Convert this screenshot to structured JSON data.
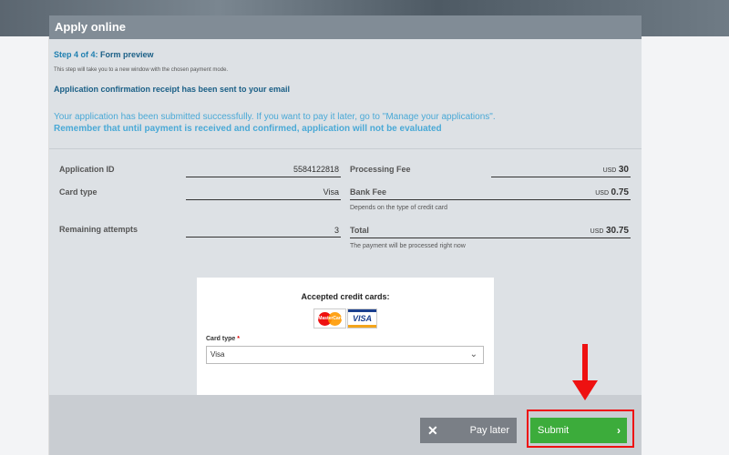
{
  "panel": {
    "title": "Apply online",
    "step_prefix": "Step 4 of 4:",
    "step_name": "Form preview",
    "step_note": "This step will take you to a new window with the chosen payment mode.",
    "confirmation": "Application confirmation receipt has been sent to your email",
    "success_msg": "Your application has been submitted successfully. If you want to pay it later, go to \"Manage your applications\".",
    "remember_msg": "Remember that until payment is received and confirmed, application will not be evaluated"
  },
  "fields": {
    "app_id": {
      "label": "Application ID",
      "value": "5584122818"
    },
    "card_type": {
      "label": "Card type",
      "value": "Visa"
    },
    "attempts": {
      "label": "Remaining attempts",
      "value": "3"
    },
    "processing_fee": {
      "label": "Processing Fee",
      "currency": "USD",
      "amount": "30"
    },
    "bank_fee": {
      "label": "Bank Fee",
      "currency": "USD",
      "amount": "0.75",
      "note": "Depends on the type of credit card"
    },
    "total": {
      "label": "Total",
      "currency": "USD",
      "amount": "30.75",
      "note": "The payment will be processed right now"
    }
  },
  "cards": {
    "title": "Accepted credit cards:",
    "mastercard": "MasterCard",
    "visa": "VISA",
    "select_label": "Card type",
    "required_mark": "*",
    "selected": "Visa"
  },
  "actions": {
    "pay_later": "Pay later",
    "submit": "Submit"
  },
  "colors": {
    "header": "#818c96",
    "submit": "#3cac3b",
    "highlight": "#ee1111",
    "link": "#4aa9d6"
  }
}
